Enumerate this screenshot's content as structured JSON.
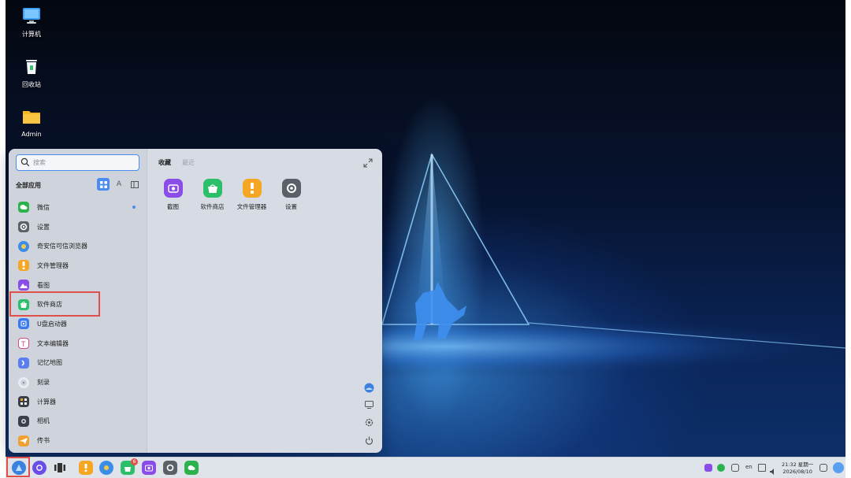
{
  "desktop": {
    "icons": [
      {
        "label": "计算机",
        "icon": "monitor-icon"
      },
      {
        "label": "回收站",
        "icon": "trash-icon"
      },
      {
        "label": "Admin",
        "icon": "folder-icon"
      }
    ]
  },
  "start_menu": {
    "search": {
      "placeholder": "搜索"
    },
    "all_apps_label": "全部应用",
    "view_toggles": [
      {
        "icon": "grid-view-icon",
        "active": true
      },
      {
        "label": "A",
        "icon": "letter-sort-icon"
      },
      {
        "icon": "category-view-icon"
      }
    ],
    "apps": [
      {
        "label": "微信",
        "icon": "wechat-icon",
        "color": "#2bb24c",
        "new": true
      },
      {
        "label": "设置",
        "icon": "settings-icon",
        "color": "#5b6068"
      },
      {
        "label": "奇安信可信浏览器",
        "icon": "browser-icon",
        "color": "#3b8ee8"
      },
      {
        "label": "文件管理器",
        "icon": "file-manager-icon",
        "color": "#f5a623"
      },
      {
        "label": "看图",
        "icon": "image-viewer-icon",
        "color": "#8a4de8"
      },
      {
        "label": "软件商店",
        "icon": "software-store-icon",
        "color": "#2bbf6a"
      },
      {
        "label": "U盘启动器",
        "icon": "usb-launcher-icon",
        "color": "#3b7bf0"
      },
      {
        "label": "文本编辑器",
        "icon": "text-editor-icon",
        "color": "#d04a8a"
      },
      {
        "label": "记忆地图",
        "icon": "memory-map-icon",
        "color": "#5b7ff0"
      },
      {
        "label": "刻录",
        "icon": "burner-icon",
        "color": "#8d96a3"
      },
      {
        "label": "计算器",
        "icon": "calculator-icon",
        "color": "#3a3f47"
      },
      {
        "label": "相机",
        "icon": "camera-icon",
        "color": "#3a3f47"
      },
      {
        "label": "传书",
        "icon": "transfer-icon",
        "color": "#f0a030"
      }
    ],
    "tabs": {
      "favorites": "收藏",
      "recent": "最近"
    },
    "favorites": [
      {
        "label": "截图",
        "icon": "screenshot-icon",
        "color": "#8a4de8"
      },
      {
        "label": "软件商店",
        "icon": "software-store-icon",
        "color": "#2bbf6a"
      },
      {
        "label": "文件管理器",
        "icon": "file-manager-icon",
        "color": "#f5a623"
      },
      {
        "label": "设置",
        "icon": "settings-icon",
        "color": "#5b6068"
      }
    ],
    "side_actions": [
      "user-avatar-icon",
      "display-icon",
      "settings-gear-icon",
      "power-icon"
    ]
  },
  "taskbar": {
    "apps": [
      {
        "icon": "start-menu-icon"
      },
      {
        "icon": "multitask-icon"
      },
      {
        "icon": "workspace-icon"
      },
      {
        "icon": "file-manager-icon"
      },
      {
        "icon": "browser-icon"
      },
      {
        "icon": "software-store-icon",
        "badge": "6"
      },
      {
        "icon": "screenshot-icon"
      },
      {
        "icon": "settings-icon"
      },
      {
        "icon": "wechat-icon"
      }
    ],
    "tray": {
      "input_method": "en",
      "time": "21:32 星期一",
      "date": "2026/08/10"
    }
  }
}
